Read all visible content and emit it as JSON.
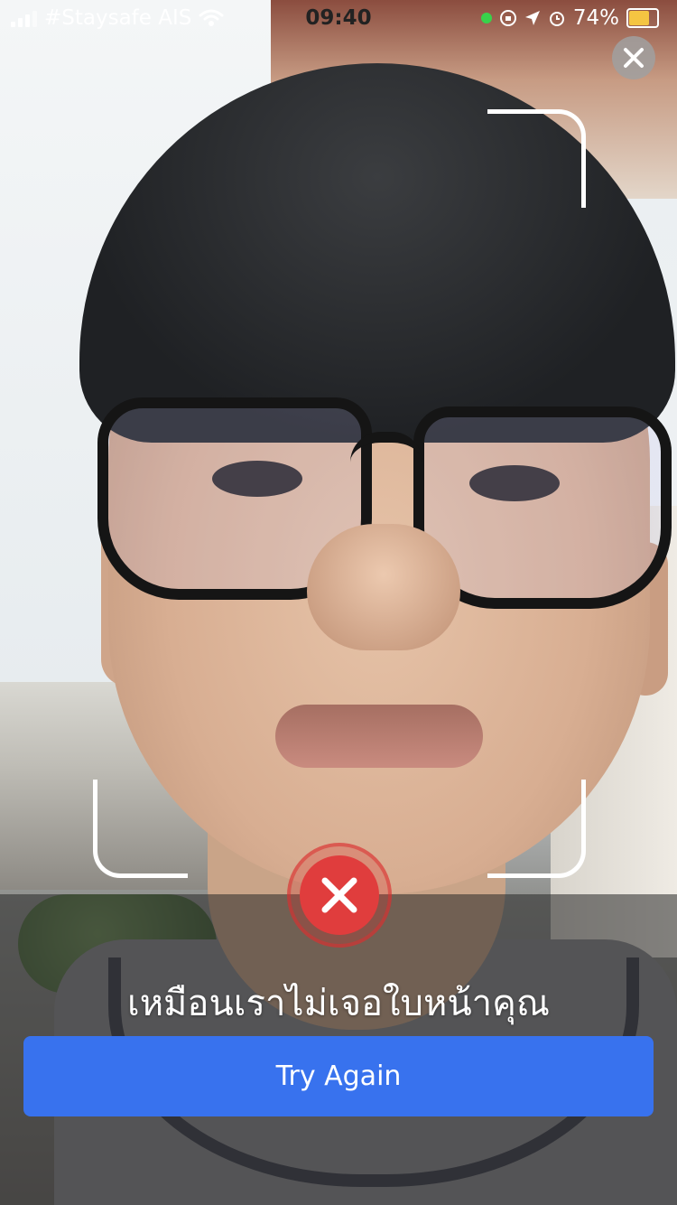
{
  "status_bar": {
    "carrier": "#Staysafe AIS",
    "time": "09:40",
    "battery": "74%",
    "battery_level": 0.74,
    "icons": [
      "signal-icon",
      "wifi-icon",
      "camera-in-use-dot",
      "rotation-lock-icon",
      "location-arrow-icon",
      "alarm-icon",
      "battery-icon"
    ]
  },
  "scan": {
    "close_icon": "close-icon",
    "error_icon": "error-x-icon",
    "message": "เหมือนเราไม่เจอใบหน้าคุณ",
    "button_label": "Try Again",
    "colors": {
      "button": "#3872ee",
      "error": "#e03d3d"
    }
  }
}
